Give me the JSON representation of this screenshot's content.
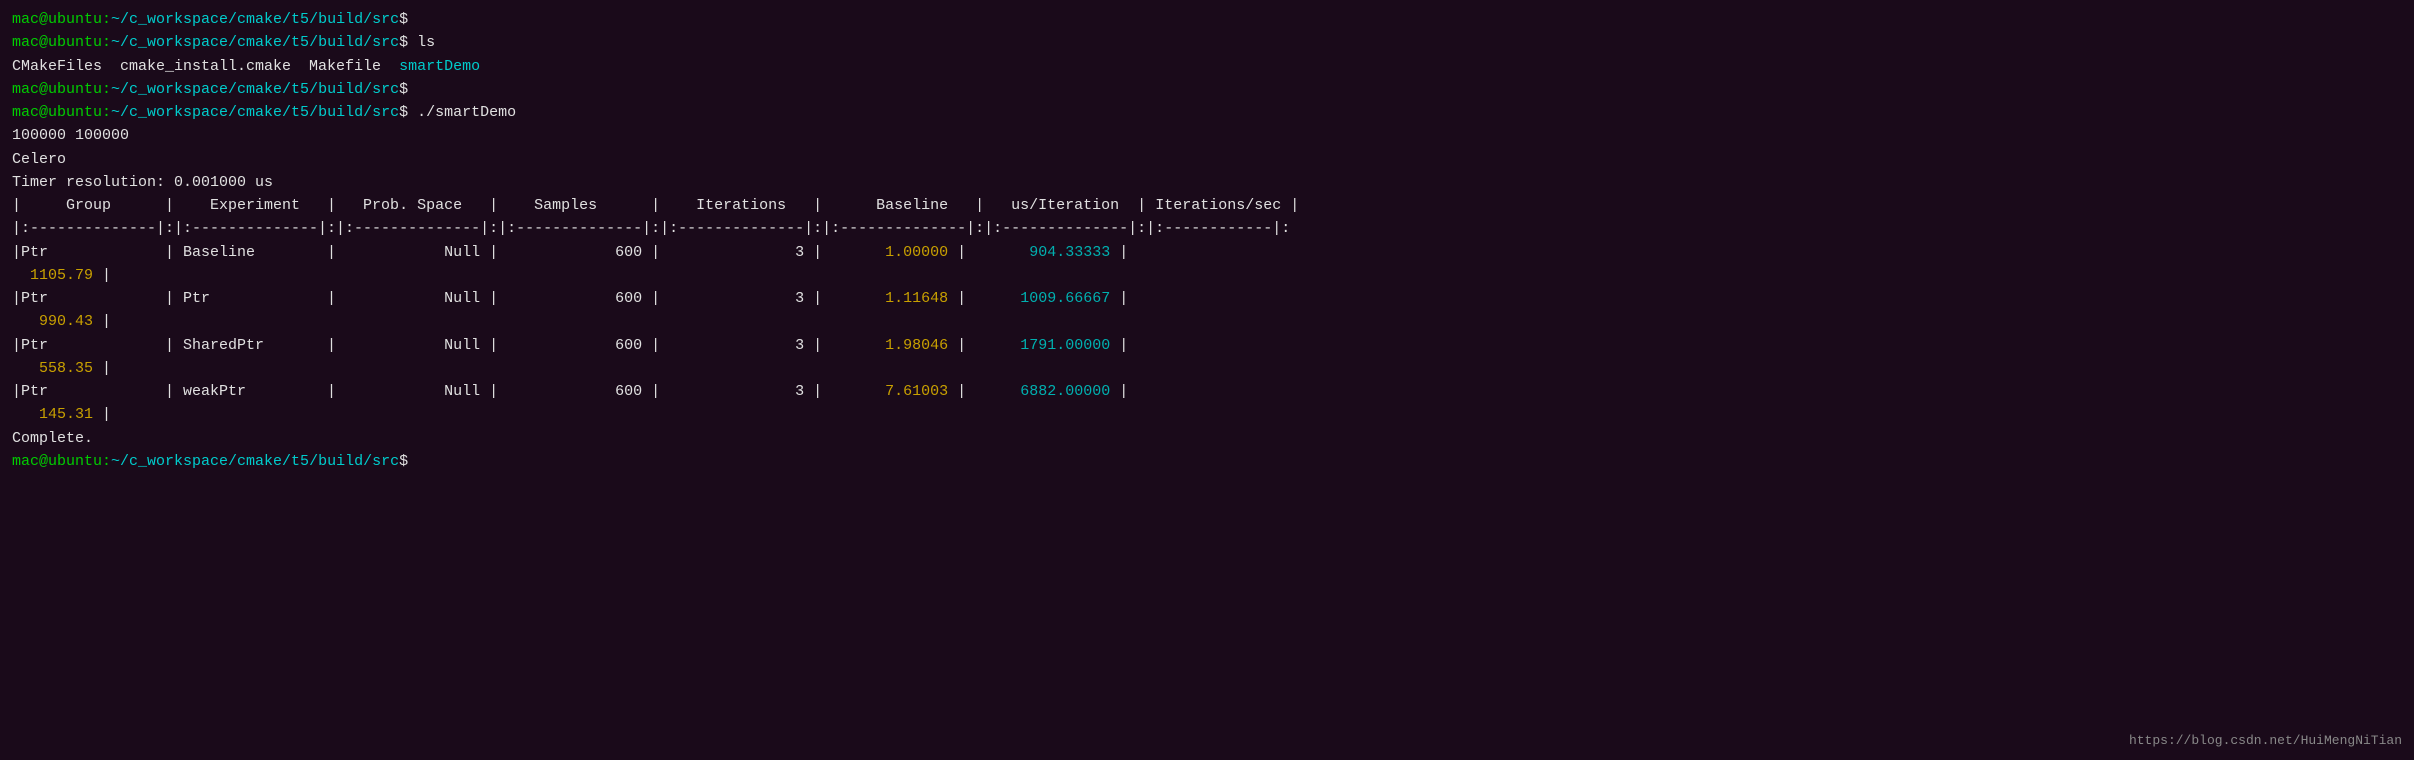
{
  "terminal": {
    "prompt_color": "#00cc00",
    "path_color": "#00cccc",
    "lines": [
      {
        "type": "prompt",
        "text": "mac@ubuntu:~/c_workspace/cmake/t5/build/src$"
      },
      {
        "type": "command",
        "prompt": "mac@ubuntu:~/c_workspace/cmake/t5/build/src$ ",
        "cmd": "ls"
      },
      {
        "type": "output_mixed",
        "parts": [
          {
            "text": "CMakeFiles  cmake_install.cmake  Makefile  ",
            "color": "white"
          },
          {
            "text": "smartDemo",
            "color": "cyan"
          }
        ]
      },
      {
        "type": "prompt",
        "text": "mac@ubuntu:~/c_workspace/cmake/t5/build/src$"
      },
      {
        "type": "command",
        "prompt": "mac@ubuntu:~/c_workspace/cmake/t5/build/src$ ",
        "cmd": "./smartDemo"
      },
      {
        "type": "output",
        "text": "100000 100000"
      },
      {
        "type": "output",
        "text": "Celero"
      },
      {
        "type": "output",
        "text": "Timer resolution: 0.001000 us"
      },
      {
        "type": "table_header",
        "text": "|     Group      |    Experiment   |   Prob. Space   |    Samples      |    Iterations   |      Baseline   |   us/Iteration  |   Iterations/sec   |"
      },
      {
        "type": "dashed"
      },
      {
        "type": "table_row_1",
        "group": "Ptr",
        "experiment": "Baseline",
        "prob_space": "Null",
        "samples": "600",
        "iterations": "3",
        "baseline_val": "1.00000",
        "us_iter": "904.33333",
        "iter_sec": "1105.79"
      },
      {
        "type": "table_row_2",
        "group": "Ptr",
        "experiment": "Ptr",
        "prob_space": "Null",
        "samples": "600",
        "iterations": "3",
        "baseline_val": "1.11648",
        "us_iter": "1009.66667",
        "iter_sec": "990.43"
      },
      {
        "type": "table_row_3",
        "group": "Ptr",
        "experiment": "SharedPtr",
        "prob_space": "Null",
        "samples": "600",
        "iterations": "3",
        "baseline_val": "1.98046",
        "us_iter": "1791.00000",
        "iter_sec": "558.35"
      },
      {
        "type": "table_row_4",
        "group": "Ptr",
        "experiment": "weakPtr",
        "prob_space": "Null",
        "samples": "600",
        "iterations": "3",
        "baseline_val": "7.61003",
        "us_iter": "6882.00000",
        "iter_sec": "145.31"
      },
      {
        "type": "output",
        "text": "Complete."
      },
      {
        "type": "prompt_partial",
        "text": "mac@ubuntu:~/c_workspace/cmake/t5/build/src$"
      }
    ],
    "watermark": "https://blog.csdn.net/HuiMengNiTian"
  }
}
